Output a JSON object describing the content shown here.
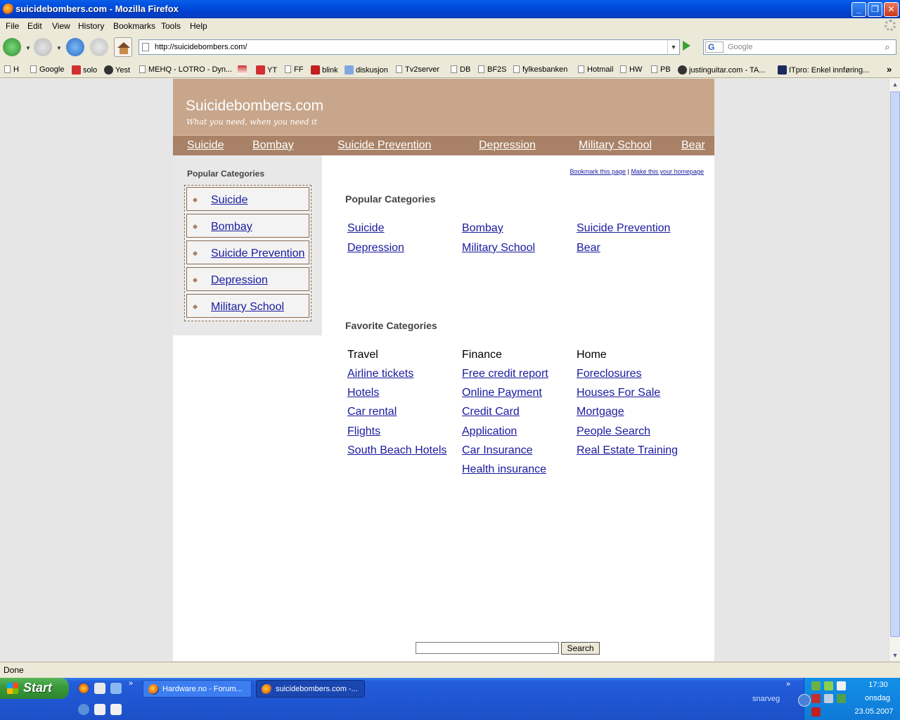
{
  "window": {
    "title": "suicidebombers.com - Mozilla Firefox",
    "controls": [
      "_",
      "❐",
      "✕"
    ]
  },
  "menubar": [
    "File",
    "Edit",
    "View",
    "History",
    "Bookmarks",
    "Tools",
    "Help"
  ],
  "navbar": {
    "url": "http://suicidebombers.com/",
    "search_placeholder": "Google",
    "search_engine": "G"
  },
  "bookmarks": [
    "H",
    "Google",
    "solo",
    "Yest",
    "MEHQ - LOTRO - Dyn...",
    "YT",
    "FF",
    "blink",
    "diskusjon",
    "Tv2server",
    "DB",
    "BF2S",
    "fylkesbanken",
    "Hotmail",
    "HW",
    "PB",
    "justinguitar.com - TA...",
    "ITpro: Enkel innføring...",
    "»"
  ],
  "site": {
    "title": "Suicidebombers.com",
    "tagline": "What you need, when you need it",
    "nav": [
      "Suicide",
      "Bombay",
      "Suicide Prevention",
      "Depression",
      "Military School",
      "Bear"
    ],
    "sidebar": {
      "heading": "Popular Categories",
      "items": [
        "Suicide",
        "Bombay",
        "Suicide Prevention",
        "Depression",
        "Military School"
      ]
    },
    "toplinks": {
      "bookmark": "Bookmark this page",
      "separator": "|",
      "homepage": "Make this your homepage"
    },
    "popular": {
      "heading": "Popular Categories",
      "links": [
        "Suicide",
        "Bombay",
        "Suicide Prevention",
        "Depression",
        "Military School",
        "Bear"
      ]
    },
    "favorite": {
      "heading": "Favorite Categories",
      "columns": [
        {
          "title": "Travel",
          "links": [
            "Airline tickets",
            "Hotels",
            "Car rental",
            "Flights",
            "South Beach Hotels"
          ]
        },
        {
          "title": "Finance",
          "links": [
            "Free credit report",
            "Online Payment",
            "Credit Card",
            "Application",
            "Car Insurance",
            "Health insurance"
          ]
        },
        {
          "title": "Home",
          "links": [
            "Foreclosures",
            "Houses For Sale",
            "Mortgage",
            "People Search",
            "Real Estate Training"
          ]
        }
      ]
    },
    "search_button": "Search"
  },
  "status": "Done",
  "taskbar": {
    "start": "Start",
    "tasks": [
      "Hardware.no - Forum...",
      "suicidebombers.com -..."
    ],
    "chevron": "»",
    "snarveg": "snarveg",
    "time": "17:30",
    "day": "onsdag",
    "date": "23.05.2007"
  },
  "colors": {
    "header_bg": "#c8a68b",
    "nav_bg": "#a88166",
    "link": "#1a1aa0"
  }
}
